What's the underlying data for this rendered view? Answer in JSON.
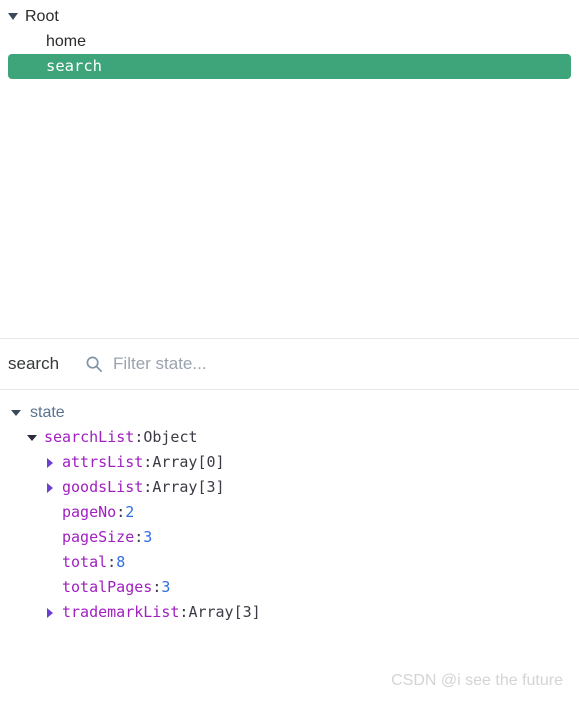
{
  "action_tree": {
    "rows": [
      {
        "label": "Root",
        "level": 0,
        "expanded": true,
        "selected": false,
        "icon": "caret-down-icon"
      },
      {
        "label": "home",
        "level": 1,
        "expanded": false,
        "selected": false,
        "icon": "none"
      },
      {
        "label": "search",
        "level": 1,
        "expanded": false,
        "selected": true,
        "icon": "none"
      }
    ]
  },
  "filter_bar": {
    "section_label": "search",
    "search_icon": "search-icon",
    "placeholder": "Filter state...",
    "value": ""
  },
  "state_tree": {
    "rows": [
      {
        "key": "state",
        "sep": "",
        "value": "",
        "value_type": "none",
        "level": 0,
        "arrow": "caret-down-dark",
        "key_style": "root"
      },
      {
        "key": "searchList",
        "sep": ": ",
        "value": "Object",
        "value_type": "type",
        "level": 1,
        "arrow": "caret-down-purple",
        "key_style": "key"
      },
      {
        "key": "attrsList",
        "sep": ": ",
        "value": "Array[0]",
        "value_type": "type",
        "level": 2,
        "arrow": "caret-right-purple",
        "key_style": "key"
      },
      {
        "key": "goodsList",
        "sep": ": ",
        "value": "Array[3]",
        "value_type": "type",
        "level": 2,
        "arrow": "caret-right-purple",
        "key_style": "key"
      },
      {
        "key": "pageNo",
        "sep": ": ",
        "value": "2",
        "value_type": "number",
        "level": 2,
        "arrow": "none",
        "key_style": "key"
      },
      {
        "key": "pageSize",
        "sep": ": ",
        "value": "3",
        "value_type": "number",
        "level": 2,
        "arrow": "none",
        "key_style": "key"
      },
      {
        "key": "total",
        "sep": ": ",
        "value": "8",
        "value_type": "number",
        "level": 2,
        "arrow": "none",
        "key_style": "key"
      },
      {
        "key": "totalPages",
        "sep": ": ",
        "value": "3",
        "value_type": "number",
        "level": 2,
        "arrow": "none",
        "key_style": "key"
      },
      {
        "key": "trademarkList",
        "sep": ": ",
        "value": "Array[3]",
        "value_type": "type",
        "level": 2,
        "arrow": "caret-right-purple",
        "key_style": "key"
      }
    ]
  },
  "watermark": {
    "text": "CSDN @i see the future"
  },
  "colors": {
    "selection_green": "#3ea57a",
    "key_purple": "#a020c0",
    "number_blue": "#2f6fe0",
    "root_blue_gray": "#5a7290",
    "divider": "#e4e6e8"
  }
}
